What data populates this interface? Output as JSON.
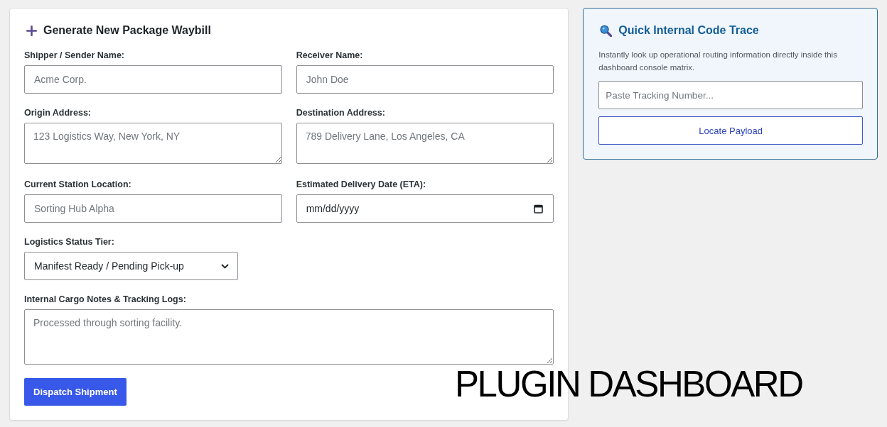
{
  "form": {
    "title": "Generate New Package Waybill",
    "rows": [
      [
        {
          "kind": "text",
          "label": "Shipper / Sender Name:",
          "placeholder": "Acme Corp."
        },
        {
          "kind": "text",
          "label": "Receiver Name:",
          "placeholder": "John Doe"
        }
      ],
      [
        {
          "kind": "textarea",
          "label": "Origin Address:",
          "placeholder": "123 Logistics Way, New York, NY"
        },
        {
          "kind": "textarea",
          "label": "Destination Address:",
          "placeholder": "789 Delivery Lane, Los Angeles, CA"
        }
      ],
      [
        {
          "kind": "text",
          "label": "Current Station Location:",
          "placeholder": "Sorting Hub Alpha"
        },
        {
          "kind": "date",
          "label": "Estimated Delivery Date (ETA):",
          "placeholder": "mm/dd/yyyy"
        }
      ],
      [
        {
          "kind": "select",
          "label": "Logistics Status Tier:",
          "value": "Manifest Ready / Pending Pick-up"
        }
      ],
      [
        {
          "kind": "textarea",
          "label": "Internal Cargo Notes & Tracking Logs:",
          "placeholder": "Processed through sorting facility."
        }
      ]
    ],
    "submit_button": "Dispatch Shipment"
  },
  "lookup": {
    "title": "Quick Internal Code Trace",
    "description": "Instantly look up operational routing information directly inside this dashboard console matrix.",
    "search": {
      "placeholder": "Paste Tracking Number..."
    },
    "button": "Locate Payload"
  },
  "overlay_caption": "PLUGIN DASHBOARD"
}
